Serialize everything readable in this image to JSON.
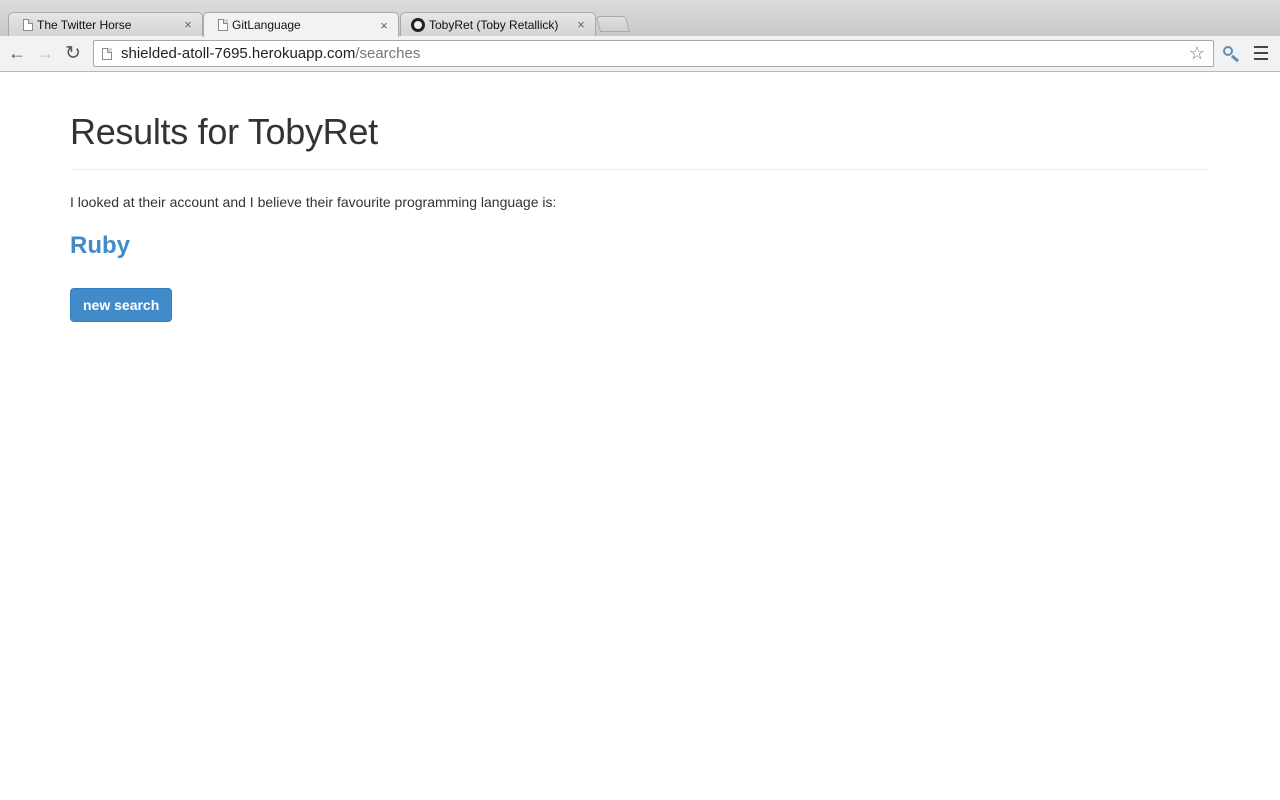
{
  "browser": {
    "tabs": [
      {
        "label": "The Twitter Horse",
        "icon": "document-icon",
        "close": "×",
        "active": false
      },
      {
        "label": "GitLanguage",
        "icon": "document-icon",
        "close": "×",
        "active": true
      },
      {
        "label": "TobyRet (Toby Retallick)",
        "icon": "github-icon",
        "close": "×",
        "active": false
      }
    ],
    "url": {
      "host": "shielded-atoll-7695.herokuapp.com",
      "path": "/searches"
    },
    "icons": {
      "back": "←",
      "forward": "→",
      "reload": "↻",
      "star": "☆"
    }
  },
  "page": {
    "title": "Results for TobyRet",
    "lead": "I looked at their account and I believe their favourite programming language is:",
    "language": "Ruby",
    "new_search_label": "new search"
  },
  "colors": {
    "accent": "#428bca",
    "text": "#333333"
  }
}
